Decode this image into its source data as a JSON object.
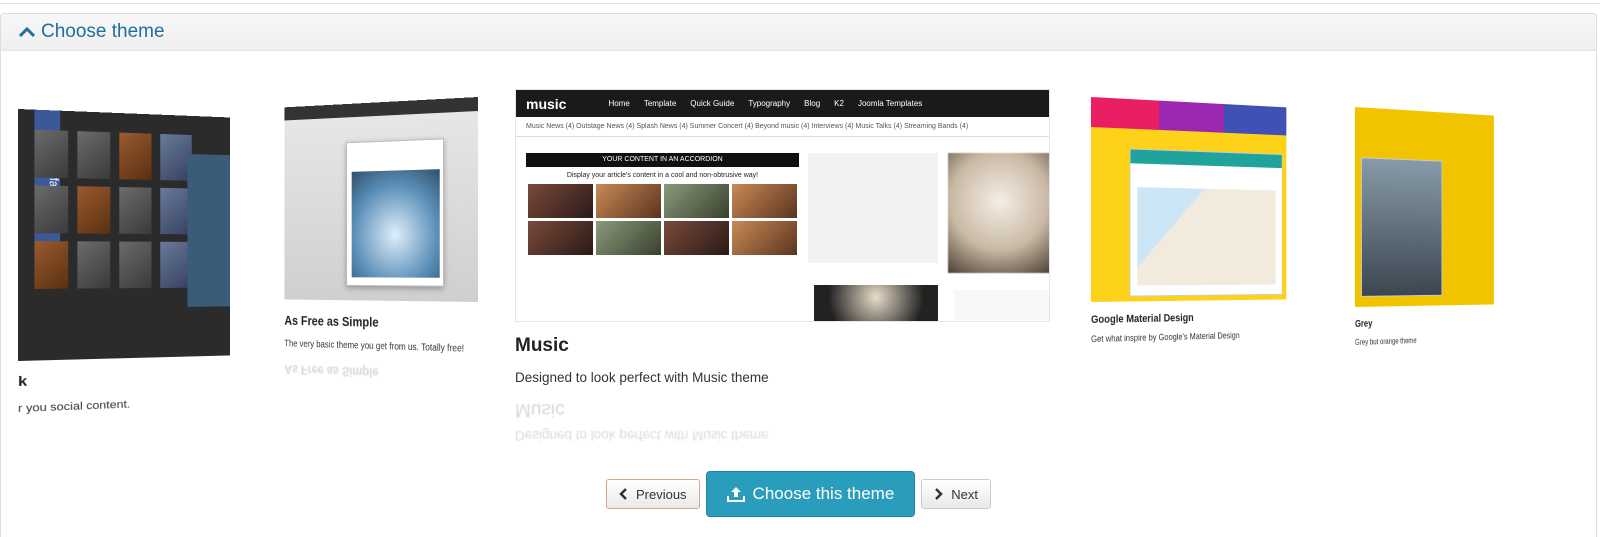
{
  "panel": {
    "heading": "Choose theme"
  },
  "themes": [
    {
      "title": "k",
      "description": "r you social content."
    },
    {
      "title": "As Free as Simple",
      "description": "The very basic theme you get from us. Totally free!"
    },
    {
      "title": "Music",
      "description": "Designed to look perfect with Music theme",
      "preview": {
        "logo": "music",
        "nav": [
          "Home",
          "Template",
          "Quick Guide",
          "Typography",
          "Blog",
          "K2",
          "Joomla Templates"
        ],
        "subnav": "Music News (4)   Outstage News (4)   Splash News (4)   Summer Concert (4)   Beyond music (4)   Interviews (4)   Music Talks (4)   Streaming Bands (4)",
        "accordion_header": "YOUR CONTENT IN AN ACCORDION",
        "accordion_sub": "Display your article's content in a cool and non-obtrusive way!"
      }
    },
    {
      "title": "Google Material Design",
      "description": "Get what inspire by Google's Material Design"
    },
    {
      "title": "Grey",
      "description": "Grey but orange theme"
    }
  ],
  "buttons": {
    "previous": "Previous",
    "choose": "Choose this theme",
    "next": "Next"
  },
  "colors": {
    "primary": "#2a9dbd",
    "link": "#1f6f9f"
  }
}
